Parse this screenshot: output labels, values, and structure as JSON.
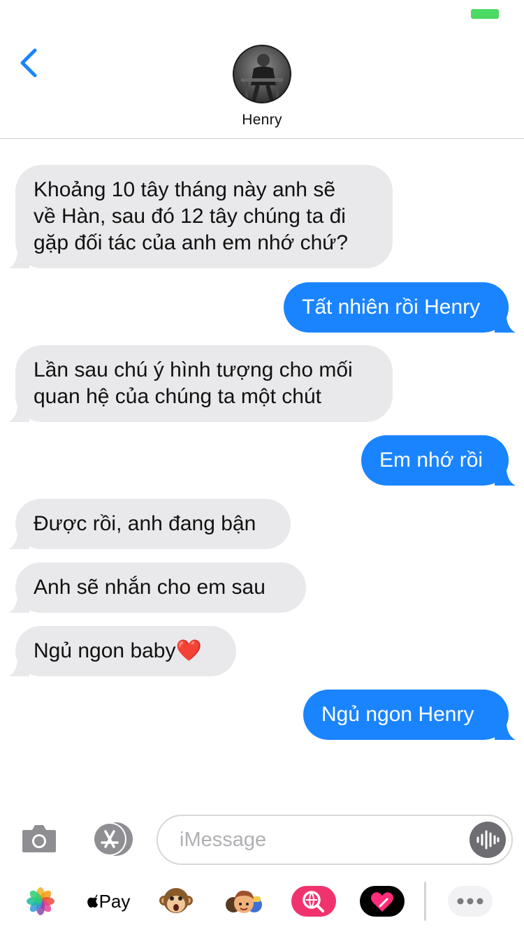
{
  "header": {
    "contact_name": "Henry"
  },
  "messages": [
    {
      "direction": "in",
      "text": "Khoảng 10 tây tháng này anh sẽ\nvề Hàn, sau đó 12 tây chúng ta đi\ngặp đối tác của anh em nhớ chứ?"
    },
    {
      "direction": "out",
      "text": "Tất nhiên rồi Henry"
    },
    {
      "direction": "in",
      "text": "Lần sau chú ý hình tượng cho mối\nquan hệ của chúng ta một chút"
    },
    {
      "direction": "out",
      "text": "Em nhớ rồi"
    },
    {
      "direction": "in",
      "text": "Được rồi, anh đang bận"
    },
    {
      "direction": "in",
      "text": "Anh sẽ nhắn cho em sau"
    },
    {
      "direction": "in",
      "text": "Ngủ ngon baby❤️"
    },
    {
      "direction": "out",
      "text": "Ngủ ngon Henry"
    }
  ],
  "composer": {
    "placeholder": "iMessage"
  },
  "app_strip": {
    "apple_pay_label": "Pay"
  },
  "colors": {
    "accent": "#1a84ff",
    "incoming_bubble": "#e9e9eb",
    "battery": "#4cd964"
  },
  "icons": [
    "back-chevron-icon",
    "camera-icon",
    "app-store-icon",
    "audio-waveform-icon",
    "photos-icon",
    "apple-icon",
    "animoji-monkey-icon",
    "memoji-icon",
    "web-search-icon",
    "digital-touch-heart-icon",
    "more-icon"
  ]
}
